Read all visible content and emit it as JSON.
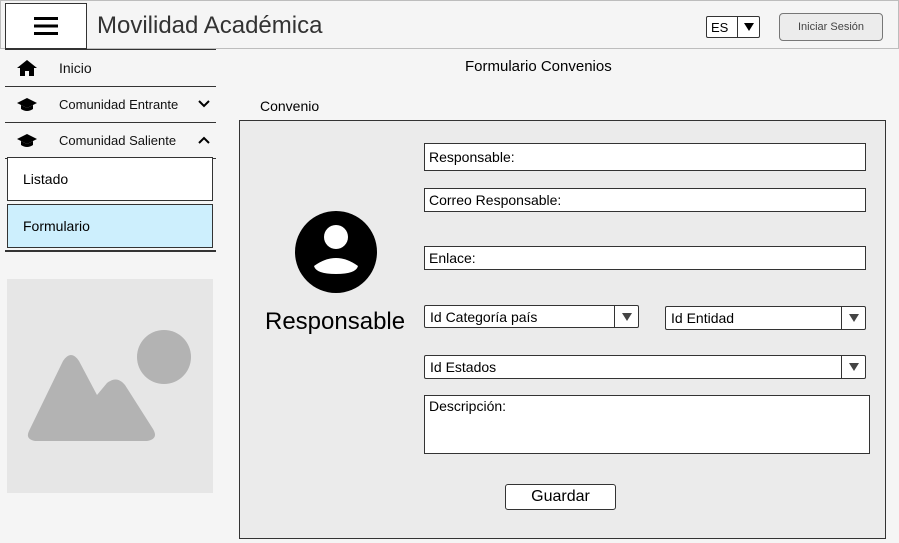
{
  "header": {
    "title": "Movilidad Académica",
    "language": "ES",
    "login_label": "Iniciar Sesión",
    "menu_icon": "hamburger-menu-icon"
  },
  "sidebar": {
    "items": [
      {
        "label": "Inicio",
        "icon": "home-icon"
      },
      {
        "label": "Comunidad Entrante",
        "icon": "graduation-cap-icon",
        "chevron": "chevron-down-icon"
      },
      {
        "label": "Comunidad Saliente",
        "icon": "graduation-cap-icon",
        "chevron": "chevron-up-icon"
      }
    ],
    "subitems": [
      {
        "label": "Listado"
      },
      {
        "label": "Formulario",
        "selected": true
      }
    ],
    "selected_color": "#cdeffd"
  },
  "main": {
    "title": "Formulario Convenios",
    "section_label": "Convenio",
    "avatar_label": "Responsable",
    "fields": {
      "responsable": "Responsable:",
      "correo": "Correo Responsable:",
      "enlace": "Enlace:",
      "descripcion": "Descripción:"
    },
    "selects": {
      "categoria": "Id Categoría país",
      "entidad": "Id Entidad",
      "estados": "Id Estados"
    },
    "save_label": "Guardar"
  }
}
